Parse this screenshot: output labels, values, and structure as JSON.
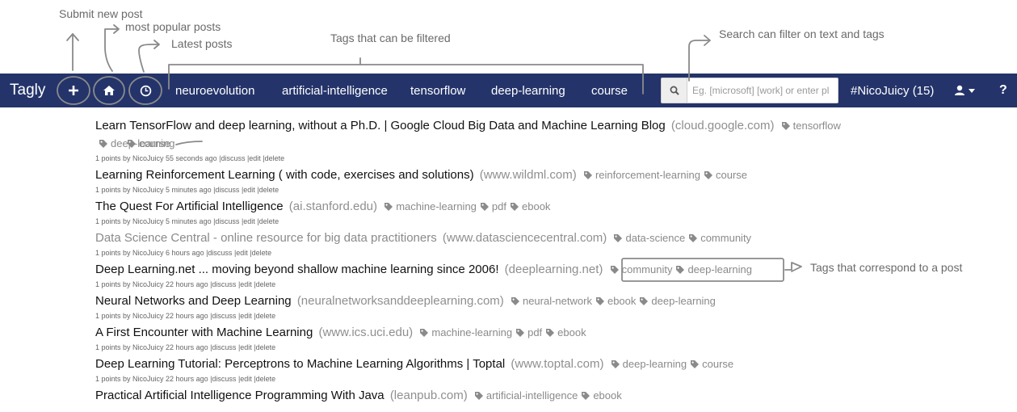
{
  "annotations": {
    "submit": "Submit new post",
    "popular": "most popular posts",
    "latest": "Latest posts",
    "tags": "Tags that can be filtered",
    "search": "Search can filter on text and tags",
    "post_tags": "Tags that correspond to a post"
  },
  "navbar": {
    "brand": "Tagly",
    "add_icon": "plus-icon",
    "home_icon": "home-icon",
    "latest_icon": "clock-icon",
    "tags": [
      "neuroevolution",
      "artificial-intelligence",
      "tensorflow",
      "deep-learning",
      "course"
    ],
    "search_placeholder": "Eg. [microsoft] [work] or enter pl",
    "user": "#NicoJuicy (15)",
    "help": "?",
    "bg_color": "#24346a"
  },
  "meta": {
    "discuss": "discuss",
    "edit": "edit",
    "delete": "delete"
  },
  "posts": [
    {
      "title": "Learn TensorFlow and deep learning, without a Ph.D. | Google Cloud Big Data and Machine Learning Blog",
      "domain": "(cloud.google.com)",
      "tags": [
        "tensorflow",
        "deep-learning",
        "course"
      ],
      "meta": "1 points by NicoJuicy 55 seconds ago |"
    },
    {
      "title": "Learning Reinforcement Learning ( with code, exercises and solutions)",
      "domain": "(www.wildml.com)",
      "tags": [
        "reinforcement-learning",
        "course"
      ],
      "meta": "1 points by NicoJuicy 5 minutes ago |"
    },
    {
      "title": "The Quest For Artificial Intelligence",
      "domain": "(ai.stanford.edu)",
      "tags": [
        "machine-learning",
        "pdf",
        "ebook"
      ],
      "meta": "1 points by NicoJuicy 5 minutes ago |"
    },
    {
      "title": "Data Science Central - online resource for big data practitioners",
      "domain": "(www.datasciencecentral.com)",
      "tags": [
        "data-science",
        "community"
      ],
      "meta": "1 points by NicoJuicy 6 hours ago |",
      "visited": true
    },
    {
      "title": "Deep Learning.net ... moving beyond shallow machine learning since 2006!",
      "domain": "(deeplearning.net)",
      "tags": [
        "community",
        "deep-learning"
      ],
      "meta": "1 points by NicoJuicy 22 hours ago |"
    },
    {
      "title": "Neural Networks and Deep Learning",
      "domain": "(neuralnetworksanddeeplearning.com)",
      "tags": [
        "neural-network",
        "ebook",
        "deep-learning"
      ],
      "meta": "1 points by NicoJuicy 22 hours ago |"
    },
    {
      "title": "A First Encounter with Machine Learning",
      "domain": "(www.ics.uci.edu)",
      "tags": [
        "machine-learning",
        "pdf",
        "ebook"
      ],
      "meta": "1 points by NicoJuicy 22 hours ago |"
    },
    {
      "title": "Deep Learning Tutorial: Perceptrons to Machine Learning Algorithms | Toptal",
      "domain": "(www.toptal.com)",
      "tags": [
        "deep-learning",
        "course"
      ],
      "meta": "1 points by NicoJuicy 22 hours ago |"
    },
    {
      "title": "Practical Artificial Intelligence Programming With Java",
      "domain": "(leanpub.com)",
      "tags": [
        "artificial-intelligence",
        "ebook"
      ]
    }
  ]
}
